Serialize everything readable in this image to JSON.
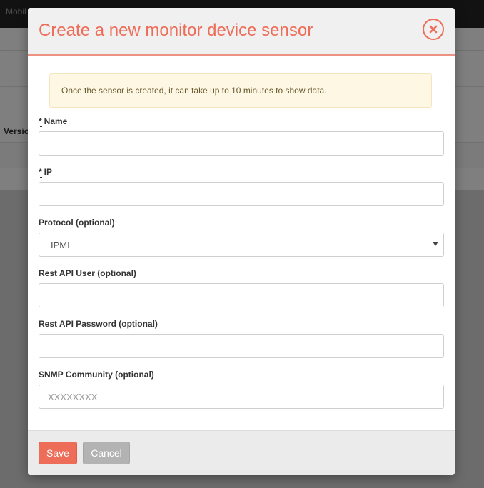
{
  "background": {
    "app_name": "Mobil",
    "table_column": "Versio"
  },
  "modal": {
    "title": "Create a new monitor device sensor",
    "close_icon": "close-icon",
    "notice": "Once the sensor is created, it can take up to 10 minutes to show data.",
    "required_marker": "*",
    "fields": {
      "name": {
        "label": "Name",
        "value": "",
        "required": true
      },
      "ip": {
        "label": "IP",
        "value": "",
        "required": true
      },
      "protocol": {
        "label": "Protocol (optional)",
        "selected": "IPMI"
      },
      "rest_user": {
        "label": "Rest API User (optional)",
        "value": ""
      },
      "rest_password": {
        "label": "Rest API Password (optional)",
        "value": ""
      },
      "snmp": {
        "label": "SNMP Community (optional)",
        "value": "",
        "placeholder": "XXXXXXXX"
      }
    },
    "footer": {
      "save_label": "Save",
      "cancel_label": "Cancel"
    }
  },
  "colors": {
    "accent": "#ee6d58",
    "cancel": "#b3b3b3",
    "notice_bg": "#fdf7e4"
  }
}
